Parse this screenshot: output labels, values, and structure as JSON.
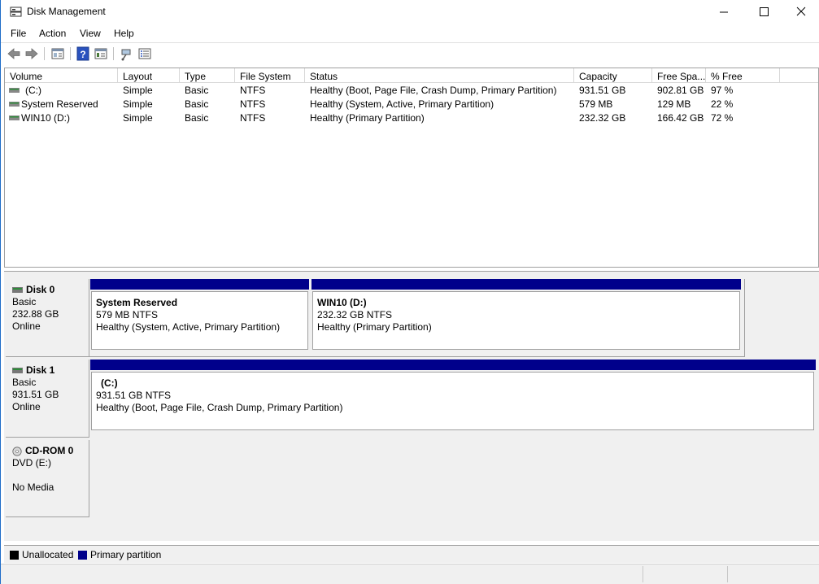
{
  "window": {
    "title": "Disk Management"
  },
  "menu": [
    "File",
    "Action",
    "View",
    "Help"
  ],
  "columns": [
    "Volume",
    "Layout",
    "Type",
    "File System",
    "Status",
    "Capacity",
    "Free Spa...",
    "% Free"
  ],
  "volumes": [
    {
      "volume": "(C:)",
      "layout": "Simple",
      "type": "Basic",
      "fs": "NTFS",
      "status": "Healthy (Boot, Page File, Crash Dump, Primary Partition)",
      "capacity": "931.51 GB",
      "free": "902.81 GB",
      "pct": "97 %"
    },
    {
      "volume": "System Reserved",
      "layout": "Simple",
      "type": "Basic",
      "fs": "NTFS",
      "status": "Healthy (System, Active, Primary Partition)",
      "capacity": "579 MB",
      "free": "129 MB",
      "pct": "22 %"
    },
    {
      "volume": "WIN10 (D:)",
      "layout": "Simple",
      "type": "Basic",
      "fs": "NTFS",
      "status": "Healthy (Primary Partition)",
      "capacity": "232.32 GB",
      "free": "166.42 GB",
      "pct": "72 %"
    }
  ],
  "disks": [
    {
      "name": "Disk 0",
      "kind": "Basic",
      "size": "232.88 GB",
      "state": "Online",
      "partitions": [
        {
          "title": "System Reserved",
          "line2": "579 MB NTFS",
          "line3": "Healthy (System, Active, Primary Partition)"
        },
        {
          "title": "WIN10  (D:)",
          "line2": "232.32 GB NTFS",
          "line3": "Healthy (Primary Partition)"
        }
      ]
    },
    {
      "name": "Disk 1",
      "kind": "Basic",
      "size": "931.51 GB",
      "state": "Online",
      "partitions": [
        {
          "title": "(C:)",
          "line2": "931.51 GB NTFS",
          "line3": "Healthy (Boot, Page File, Crash Dump, Primary Partition)"
        }
      ]
    }
  ],
  "cdrom": {
    "name": "CD-ROM 0",
    "drive": "DVD (E:)",
    "media": "No Media"
  },
  "legend": {
    "unallocated": "Unallocated",
    "primary": "Primary partition",
    "unallocated_color": "#000000",
    "primary_color": "#00008b"
  },
  "icons": {
    "app": "disk-management-icon",
    "toolbar": [
      "back-arrow-icon",
      "forward-arrow-icon",
      "console-tree-icon",
      "help-icon",
      "properties-icon",
      "connect-icon",
      "list-view-icon"
    ]
  }
}
